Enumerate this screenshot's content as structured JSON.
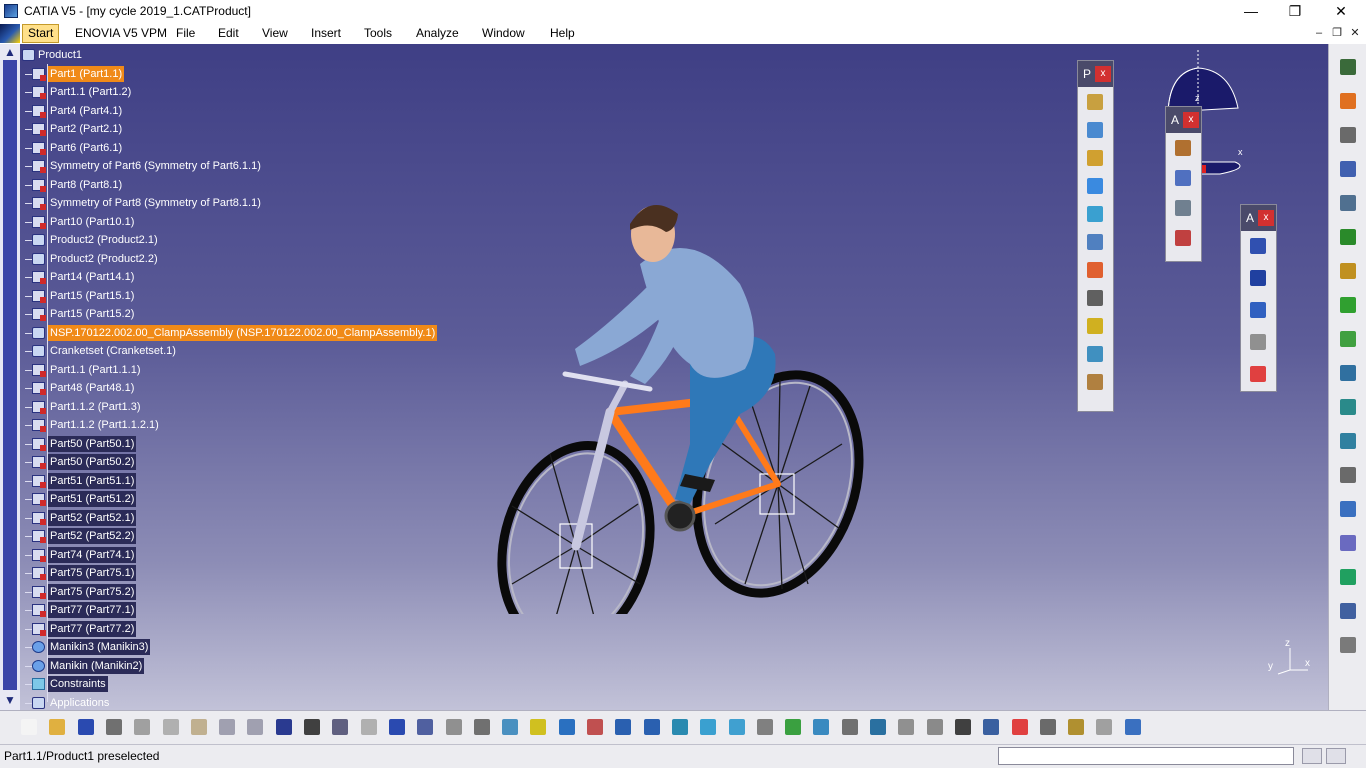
{
  "window": {
    "title": "CATIA V5 - [my cycle 2019_1.CATProduct]",
    "minimize": "—",
    "restore": "❐",
    "close": "✕"
  },
  "menu": {
    "items": [
      "Start",
      "ENOVIA V5 VPM",
      "File",
      "Edit",
      "View",
      "Insert",
      "Tools",
      "Analyze",
      "Window",
      "Help"
    ],
    "mdi_minimize": "–",
    "mdi_restore": "❐",
    "mdi_close": "✕"
  },
  "tree": {
    "root": "Product1",
    "nodes": [
      {
        "label": "Part1 (Part1.1)",
        "icon": "part-icon",
        "selected": true
      },
      {
        "label": "Part1.1 (Part1.2)",
        "icon": "part-icon"
      },
      {
        "label": "Part4 (Part4.1)",
        "icon": "part-icon"
      },
      {
        "label": "Part2 (Part2.1)",
        "icon": "part-icon"
      },
      {
        "label": "Part6 (Part6.1)",
        "icon": "part-icon"
      },
      {
        "label": "Symmetry of Part6 (Symmetry of Part6.1.1)",
        "icon": "part-icon"
      },
      {
        "label": "Part8 (Part8.1)",
        "icon": "part-icon"
      },
      {
        "label": "Symmetry of Part8 (Symmetry of Part8.1.1)",
        "icon": "part-icon"
      },
      {
        "label": "Part10 (Part10.1)",
        "icon": "part-icon"
      },
      {
        "label": "Product2 (Product2.1)",
        "icon": "product-icon"
      },
      {
        "label": "Product2 (Product2.2)",
        "icon": "product-icon"
      },
      {
        "label": "Part14 (Part14.1)",
        "icon": "part-icon"
      },
      {
        "label": "Part15 (Part15.1)",
        "icon": "part-icon"
      },
      {
        "label": "Part15 (Part15.2)",
        "icon": "part-icon"
      },
      {
        "label": "NSP.170122.002.00_ClampAssembly (NSP.170122.002.00_ClampAssembly.1)",
        "icon": "product-icon",
        "selected": true
      },
      {
        "label": "Cranketset (Cranketset.1)",
        "icon": "product-icon"
      },
      {
        "label": "Part1.1 (Part1.1.1)",
        "icon": "part-icon"
      },
      {
        "label": "Part48 (Part48.1)",
        "icon": "part-icon"
      },
      {
        "label": "Part1.1.2 (Part1.3)",
        "icon": "part-icon"
      },
      {
        "label": "Part1.1.2 (Part1.1.2.1)",
        "icon": "part-icon"
      },
      {
        "label": "Part50 (Part50.1)",
        "icon": "part-icon",
        "boxed": true
      },
      {
        "label": "Part50 (Part50.2)",
        "icon": "part-icon",
        "boxed": true
      },
      {
        "label": "Part51 (Part51.1)",
        "icon": "part-icon",
        "boxed": true
      },
      {
        "label": "Part51 (Part51.2)",
        "icon": "part-icon",
        "boxed": true
      },
      {
        "label": "Part52 (Part52.1)",
        "icon": "part-icon",
        "boxed": true
      },
      {
        "label": "Part52 (Part52.2)",
        "icon": "part-icon",
        "boxed": true
      },
      {
        "label": "Part74 (Part74.1)",
        "icon": "part-icon",
        "boxed": true
      },
      {
        "label": "Part75 (Part75.1)",
        "icon": "part-icon",
        "boxed": true
      },
      {
        "label": "Part75 (Part75.2)",
        "icon": "part-icon",
        "boxed": true
      },
      {
        "label": "Part77 (Part77.1)",
        "icon": "part-icon",
        "boxed": true
      },
      {
        "label": "Part77 (Part77.2)",
        "icon": "part-icon",
        "boxed": true
      },
      {
        "label": "Manikin3 (Manikin3)",
        "icon": "manikin-icon",
        "boxed": true
      },
      {
        "label": "Manikin (Manikin2)",
        "icon": "manikin-icon",
        "boxed": true
      },
      {
        "label": "Constraints",
        "icon": "constraints-icon",
        "boxed": true
      },
      {
        "label": "Applications",
        "icon": "applications-icon"
      }
    ]
  },
  "floating_toolbars": {
    "p": {
      "title": "P",
      "close": "x"
    },
    "a1": {
      "title": "A",
      "close": "x"
    },
    "a2": {
      "title": "A",
      "close": "x"
    }
  },
  "compass": {
    "z": "z",
    "x": "x"
  },
  "axis": {
    "z": "z",
    "x": "x",
    "y": "y"
  },
  "status": {
    "message": "Part1.1/Product1 preselected",
    "command": ""
  },
  "colors": {
    "selection": "#f08a18",
    "background_top": "#3f3f85",
    "background_bottom": "#c2c2d8",
    "frame": "#ff7a1a"
  }
}
